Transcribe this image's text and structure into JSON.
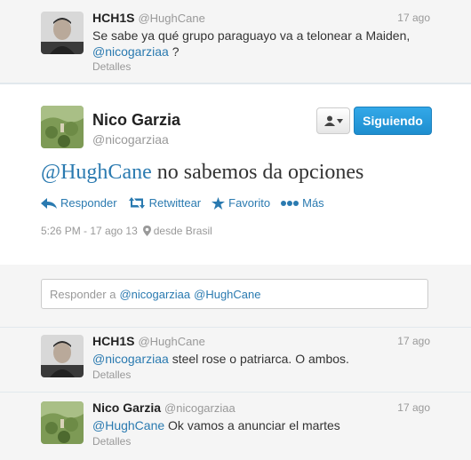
{
  "top_tweet": {
    "name": "HCH1S",
    "handle": "@HughCane",
    "time": "17 ago",
    "text_line1": "Se sabe ya qué grupo paraguayo va a telonear a Maiden,",
    "mention": "@nicogarziaa",
    "text_tail": " ?",
    "details": "Detalles"
  },
  "main_tweet": {
    "name": "Nico Garzia",
    "handle": "@nicogarziaa",
    "follow_label": "Siguiendo",
    "mention": "@HughCane",
    "text": " no sabemos da opciones",
    "actions": {
      "reply": "Responder",
      "retweet": "Retwittear",
      "favorite": "Favorito",
      "more": "Más"
    },
    "timestamp": "5:26 PM - 17 ago 13",
    "location": "desde Brasil"
  },
  "reply_box": {
    "prefix": "Responder a",
    "mention1": "@nicogarziaa",
    "mention2": "@HughCane"
  },
  "replies": [
    {
      "name": "HCH1S",
      "handle": "@HughCane",
      "time": "17 ago",
      "mention": "@nicogarziaa",
      "text": " steel rose o patriarca. O ambos.",
      "details": "Detalles"
    },
    {
      "name": "Nico Garzia",
      "handle": "@nicogarziaa",
      "time": "17 ago",
      "mention": "@HughCane",
      "text": " Ok vamos a anunciar el martes",
      "details": "Detalles"
    }
  ],
  "colors": {
    "link": "#2a7ab0",
    "follow_button": "#1e8ecf",
    "muted": "#999999"
  }
}
